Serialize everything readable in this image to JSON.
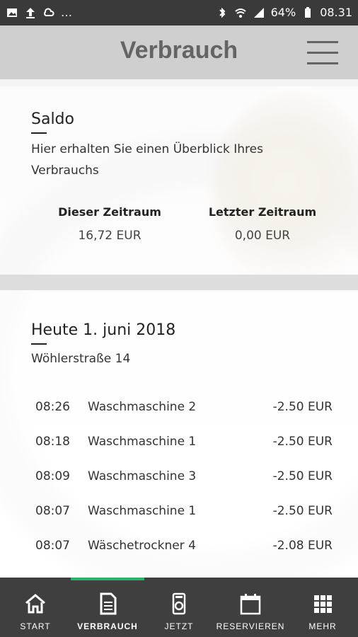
{
  "status_bar": {
    "left_icons": [
      "image-icon",
      "upload-icon",
      "cloud-icon",
      "more-dots"
    ],
    "right_icons": [
      "bluetooth-icon",
      "wifi-icon",
      "signal-icon",
      "battery-icon"
    ],
    "battery": "64%",
    "time": "08.31"
  },
  "header": {
    "title": "Verbrauch",
    "menu_icon": "hamburger-menu-icon"
  },
  "saldo": {
    "title": "Saldo",
    "description_line1": "Hier erhalten Sie einen Überblick Ihres",
    "description_line2": "Verbrauchs",
    "current_label": "Dieser Zeitraum",
    "current_value": "16,72 EUR",
    "last_label": "Letzter Zeitraum",
    "last_value": "0,00 EUR"
  },
  "day": {
    "title": "Heute 1. juni 2018",
    "address": "Wöhlerstraße 14",
    "entries": [
      {
        "time": "08:26",
        "name": "Waschmaschine 2",
        "amount": "-2.50 EUR"
      },
      {
        "time": "08:18",
        "name": "Waschmaschine 1",
        "amount": "-2.50 EUR"
      },
      {
        "time": "08:09",
        "name": "Waschmaschine 3",
        "amount": "-2.50 EUR"
      },
      {
        "time": "08:07",
        "name": "Waschmaschine 1",
        "amount": "-2.50 EUR"
      },
      {
        "time": "08:07",
        "name": "Wäschetrockner 4",
        "amount": "-2.08 EUR"
      }
    ]
  },
  "bottom_nav": {
    "items": [
      {
        "label": "START",
        "icon": "home-icon"
      },
      {
        "label": "VERBRAUCH",
        "icon": "document-icon"
      },
      {
        "label": "JETZT",
        "icon": "washing-machine-icon"
      },
      {
        "label": "RESERVIEREN",
        "icon": "calendar-icon"
      },
      {
        "label": "MEHR",
        "icon": "grid-icon"
      }
    ],
    "active_color": "#2bb36a"
  }
}
